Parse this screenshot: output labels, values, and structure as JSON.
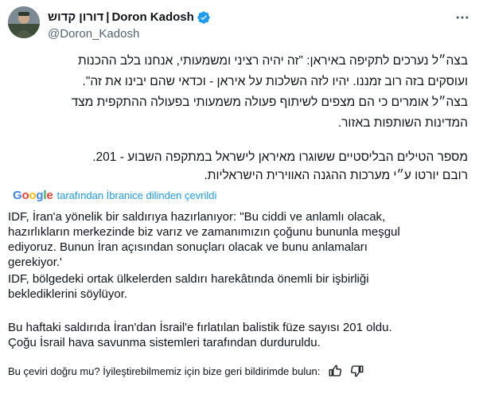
{
  "author": {
    "display_name_hebrew": "דורון קדוש",
    "separator": "|",
    "display_name_latin": "Doron Kadosh",
    "handle": "@Doron_Kadosh",
    "verified_color": "#1d9bf0"
  },
  "tweet_hebrew": {
    "line1": "בצה״ל נערכים לתקיפה באיראן: \"זה יהיה רציני ומשמעותי, אנחנו בלב ההכנות",
    "line2": "ועוסקים בזה רוב זמננו. יהיו לזה השלכות על איראן - וכדאי שהם יבינו את זה\".",
    "line3": "בצה״ל אומרים כי הם מצפים לשיתוף פעולה משמעותי בפעולה ההתקפית מצד",
    "line4": "המדינות השותפות באזור.",
    "line5": "מספר הטילים הבליסטיים ששוגרו מאיראן לישראל במתקפה השבוע - 201.",
    "line6": "רובם יורטו ע״י מערכות ההגנה האווירית הישראליות."
  },
  "translation": {
    "google_letters": [
      "G",
      "o",
      "o",
      "g",
      "l",
      "e"
    ],
    "google_colors": [
      "#4285F4",
      "#EA4335",
      "#FBBC05",
      "#4285F4",
      "#34A853",
      "#EA4335"
    ],
    "link_text": "tarafından İbranice dilinden çevrildi",
    "line1": "IDF, İran'a yönelik bir saldırıya hazırlanıyor: \"Bu ciddi ve anlamlı olacak,",
    "line2": "hazırlıkların merkezinde biz varız ve zamanımızın çoğunu bununla meşgul",
    "line3": "ediyoruz. Bunun İran açısından sonuçları olacak ve bunu anlamaları",
    "line4": "gerekiyor.'",
    "line5": "IDF, bölgedeki ortak ülkelerden saldırı harekâtında önemli bir işbirliği",
    "line6": "beklediklerini söylüyor.",
    "line7": "Bu haftaki saldırıda İran'dan İsrail'e fırlatılan balistik füze sayısı 201 oldu.",
    "line8": "Çoğu İsrail hava savunma sistemleri tarafından durduruldu."
  },
  "feedback": {
    "question": "Bu çeviri doğru mu? İyileştirebilmemiz için bize geri bildirimde bulun:"
  }
}
